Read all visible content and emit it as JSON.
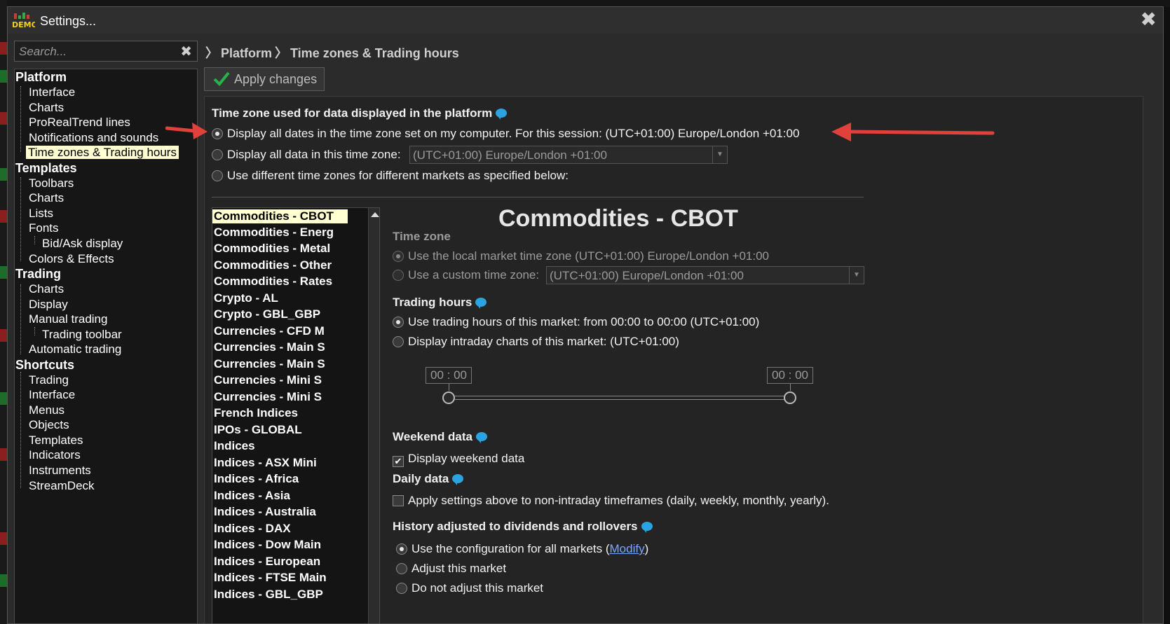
{
  "window": {
    "title": "Settings...",
    "close": "✖",
    "logo_text": "DEMO"
  },
  "search": {
    "placeholder": "Search...",
    "value": ""
  },
  "breadcrumb": {
    "items": [
      "Platform",
      "Time zones & Trading hours"
    ]
  },
  "toolbar": {
    "apply_label": "Apply changes"
  },
  "tree": {
    "platform": {
      "label": "Platform",
      "items": [
        "Interface",
        "Charts",
        "ProRealTrend lines",
        "Notifications and sounds",
        "Time zones & Trading hours"
      ]
    },
    "templates": {
      "label": "Templates",
      "items": [
        "Toolbars",
        "Charts",
        "Lists",
        "Fonts",
        "Bid/Ask display",
        "Colors & Effects"
      ]
    },
    "trading": {
      "label": "Trading",
      "items": [
        "Charts",
        "Display",
        "Manual trading",
        "Trading toolbar",
        "Automatic trading"
      ]
    },
    "shortcuts": {
      "label": "Shortcuts",
      "items": [
        "Trading",
        "Interface",
        "Menus",
        "Objects",
        "Templates",
        "Indicators",
        "Instruments",
        "StreamDeck"
      ]
    }
  },
  "timezone_section": {
    "title": "Time zone used for data displayed in the platform",
    "option1": "Display all dates in the time zone set on my computer. For this session:  (UTC+01:00) Europe/London +01:00",
    "option2": "Display all data in this time zone:",
    "option2_select": "(UTC+01:00) Europe/London +01:00",
    "option3": "Use different time zones for different markets as specified below:"
  },
  "markets": [
    "Commodities - CBOT",
    "Commodities - Energ",
    "Commodities - Metal",
    "Commodities - Other",
    "Commodities - Rates",
    "Crypto - AL",
    "Crypto - GBL_GBP",
    "Currencies - CFD M",
    "Currencies - Main S",
    "Currencies - Main S",
    "Currencies - Mini S",
    "Currencies - Mini S",
    "French Indices",
    "IPOs - GLOBAL",
    "Indices",
    "Indices - ASX Mini",
    "Indices - Africa",
    "Indices - Asia",
    "Indices - Australia",
    "Indices - DAX",
    "Indices - Dow Main",
    "Indices - European",
    "Indices - FTSE Main",
    "Indices - GBL_GBP"
  ],
  "detail": {
    "title": "Commodities - CBOT",
    "tz_heading": "Time zone",
    "tz_local": "Use the local market time zone (UTC+01:00) Europe/London +01:00",
    "tz_custom": "Use a custom time zone:",
    "tz_custom_select": "(UTC+01:00) Europe/London +01:00",
    "hours_heading": "Trading hours",
    "hours_market": "Use trading hours of this market: from 00:00 to 00:00 (UTC+01:00)",
    "hours_intraday": "Display intraday charts of this market: (UTC+01:00)",
    "slider_start": "00 : 00",
    "slider_end": "00 : 00",
    "weekend_heading": "Weekend data",
    "weekend_check": "Display weekend data",
    "daily_heading": "Daily data",
    "daily_check": "Apply settings above to non-intraday timeframes (daily, weekly, monthly, yearly).",
    "history_heading": "History adjusted to dividends and rollovers",
    "history_opt1": "Use the configuration for all markets (",
    "history_opt1_link": "Modify",
    "history_opt1_end": ")",
    "history_opt2": "Adjust this market",
    "history_opt3": "Do not adjust this market"
  },
  "colors": {
    "accent_arrow": "#e0413a",
    "selection": "#ffffd2",
    "info_bubble": "#2aa3e0",
    "check_green": "#27b34a"
  }
}
